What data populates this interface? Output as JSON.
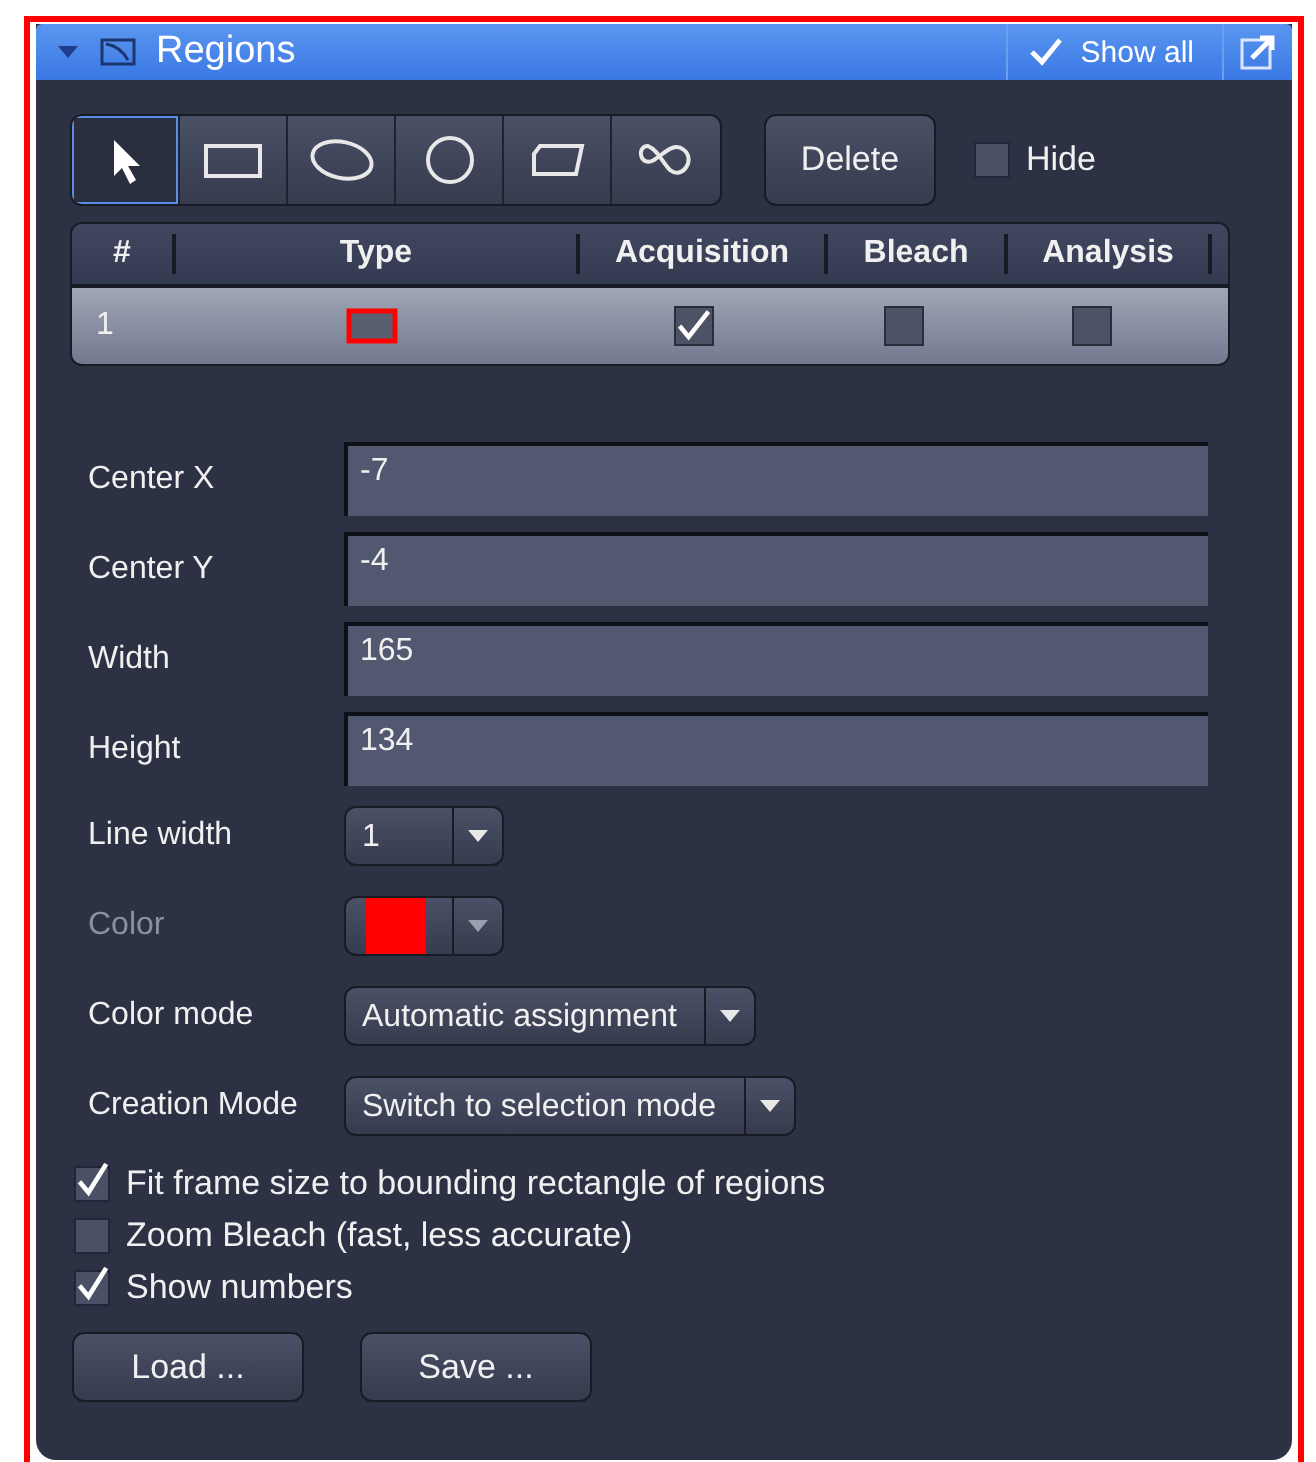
{
  "header": {
    "title": "Regions",
    "expanded": true,
    "show_all": {
      "label": "Show all",
      "checked": true
    }
  },
  "tools": [
    {
      "kind": "pointer",
      "selected": true
    },
    {
      "kind": "rectangle",
      "selected": false
    },
    {
      "kind": "ellipse",
      "selected": false
    },
    {
      "kind": "circle",
      "selected": false
    },
    {
      "kind": "polygon",
      "selected": false
    },
    {
      "kind": "freehand",
      "selected": false
    }
  ],
  "delete_button": "Delete",
  "hide": {
    "label": "Hide",
    "checked": false
  },
  "table": {
    "columns": [
      "#",
      "Type",
      "Acquisition",
      "Bleach",
      "Analysis"
    ],
    "rows": [
      {
        "number": "1",
        "type": {
          "kind": "rectangle",
          "color": "#ff0000"
        },
        "acquisition": true,
        "bleach": false,
        "analysis": false,
        "selected": true
      }
    ]
  },
  "fields": [
    {
      "label": "Center X",
      "value": "-7"
    },
    {
      "label": "Center Y",
      "value": "-4"
    },
    {
      "label": "Width",
      "value": "165"
    },
    {
      "label": "Height",
      "value": "134"
    }
  ],
  "dropdowns": [
    {
      "kind": "text",
      "label": "Line width",
      "value": "1",
      "disabled": false
    },
    {
      "kind": "color",
      "label": "Color",
      "color": "#ff0000",
      "disabled": true
    },
    {
      "kind": "text",
      "label": "Color mode",
      "value": "Automatic assignment",
      "disabled": false
    },
    {
      "kind": "text",
      "label": "Creation Mode",
      "value": "Switch to selection mode",
      "disabled": false
    }
  ],
  "options": [
    {
      "label": "Fit frame size to bounding rectangle of regions",
      "checked": true
    },
    {
      "label": "Zoom Bleach (fast, less accurate)",
      "checked": false
    },
    {
      "label": "Show numbers",
      "checked": true
    }
  ],
  "buttons": [
    "Load ...",
    "Save ..."
  ]
}
